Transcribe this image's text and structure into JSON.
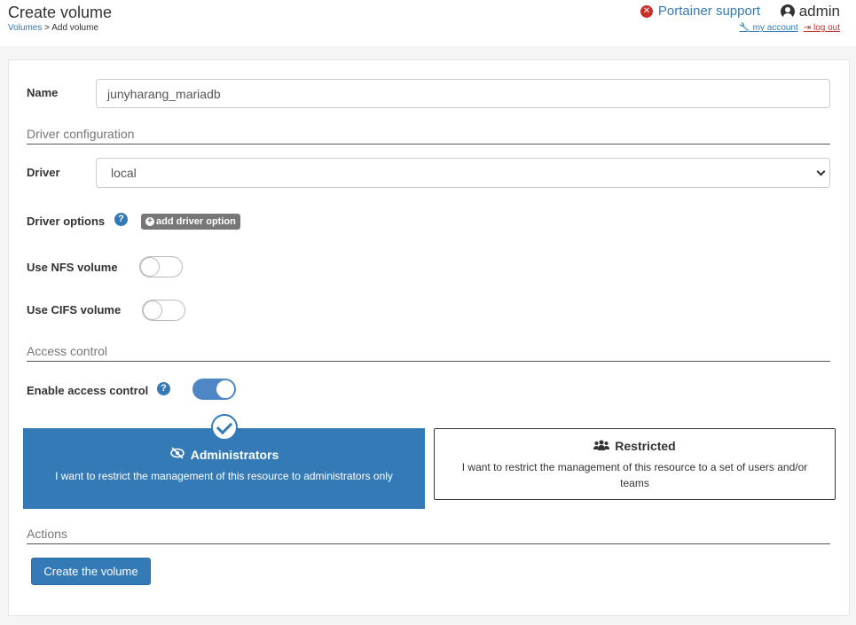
{
  "header": {
    "title": "Create volume",
    "breadcrumb_link": "Volumes",
    "breadcrumb_current": "> Add volume",
    "support_label": "Portainer support",
    "user_name": "admin",
    "my_account_label": "my account",
    "log_out_label": "log out"
  },
  "form": {
    "name_label": "Name",
    "name_value": "junyharang_mariadb",
    "driver_config_title": "Driver configuration",
    "driver_label": "Driver",
    "driver_value": "local",
    "driver_options_label": "Driver options",
    "add_driver_option_label": "add driver option",
    "nfs_label": "Use NFS volume",
    "nfs_enabled": false,
    "cifs_label": "Use CIFS volume",
    "cifs_enabled": false
  },
  "access_control": {
    "section_title": "Access control",
    "enable_label": "Enable access control",
    "enabled": true,
    "admin_title": "Administrators",
    "admin_desc": "I want to restrict the management of this resource to administrators only",
    "restricted_title": "Restricted",
    "restricted_desc": "I want to restrict the management of this resource to a set of users and/or teams",
    "selected": "Administrators"
  },
  "actions": {
    "section_title": "Actions",
    "create_label": "Create the volume"
  },
  "colors": {
    "primary": "#337ab7",
    "danger": "#c9302c",
    "toggle_on": "#4f86c6"
  }
}
